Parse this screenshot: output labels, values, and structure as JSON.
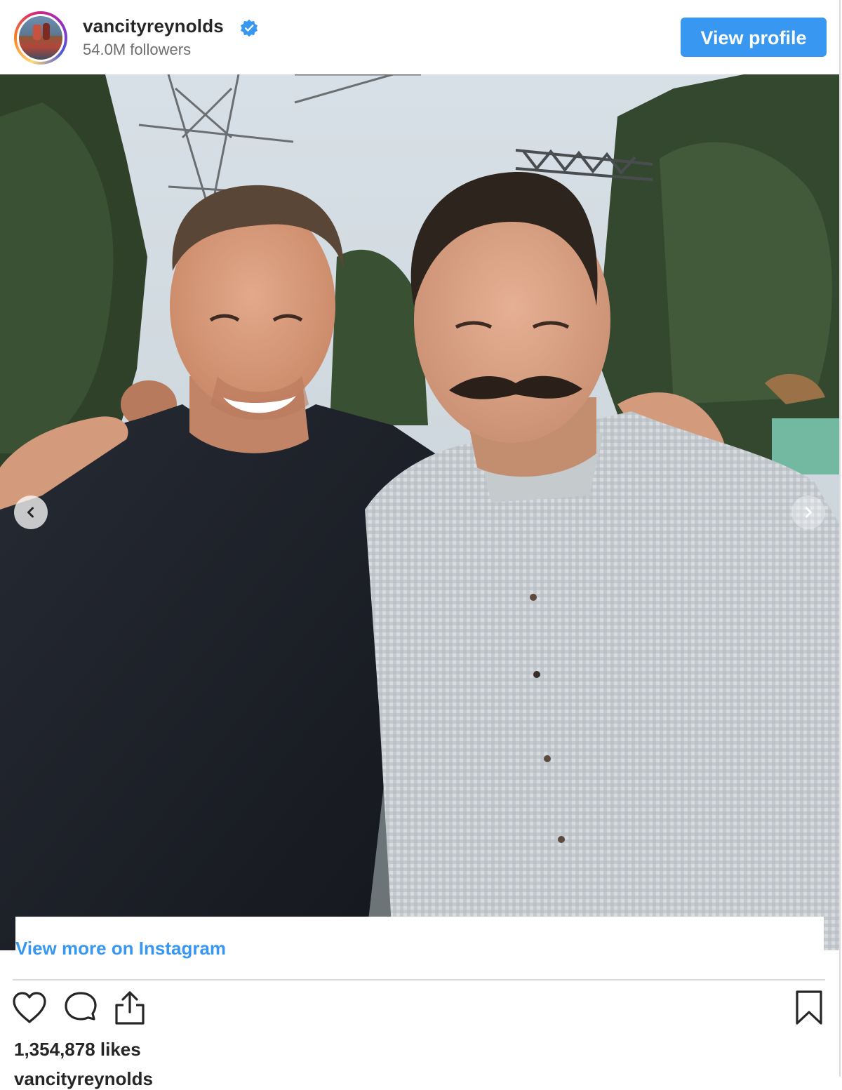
{
  "header": {
    "username": "vancityreynolds",
    "followers": "54.0M followers",
    "view_profile_label": "View profile"
  },
  "post": {
    "image_alt": "Two smiling men posing together outdoors under power lines",
    "view_more_label": "View more on Instagram",
    "likes": "1,354,878 likes",
    "caption_fragment": "vancityreynolds"
  },
  "icons": {
    "verified": "verified-badge-icon",
    "like": "heart-icon",
    "comment": "comment-bubble-icon",
    "share": "share-upload-icon",
    "save": "bookmark-icon",
    "prev": "chevron-left-icon",
    "next": "chevron-right-icon"
  },
  "colors": {
    "accent": "#3897f0",
    "text": "#262626",
    "muted": "#6e6e6e",
    "divider": "#dbdbdb"
  }
}
